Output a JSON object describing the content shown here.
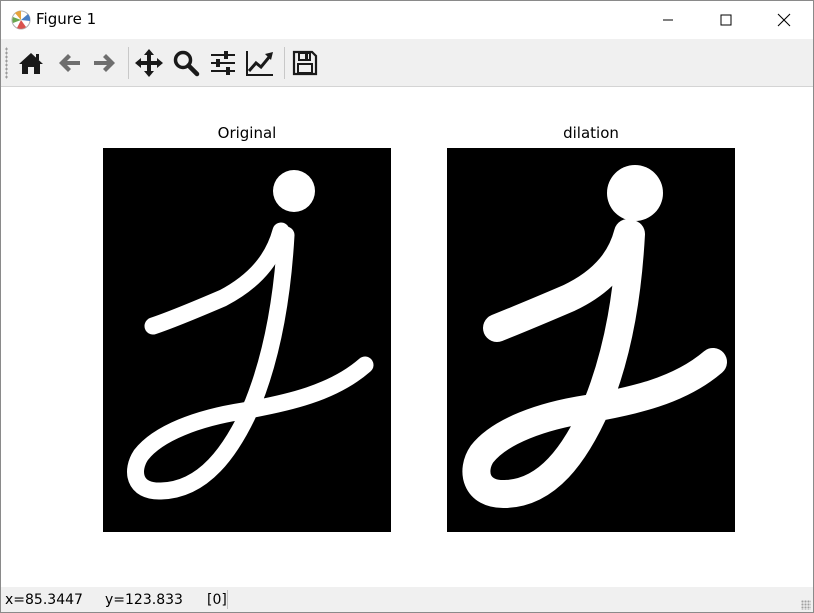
{
  "window": {
    "title": "Figure 1",
    "minimize_icon": "minimize-icon",
    "maximize_icon": "maximize-icon",
    "close_icon": "close-icon"
  },
  "toolbar": {
    "buttons": [
      {
        "name": "home-button",
        "icon": "home-icon"
      },
      {
        "name": "back-button",
        "icon": "arrow-left-icon"
      },
      {
        "name": "forward-button",
        "icon": "arrow-right-icon"
      },
      {
        "name": "pan-button",
        "icon": "move-icon"
      },
      {
        "name": "zoom-button",
        "icon": "magnifier-icon"
      },
      {
        "name": "configure-subplots-button",
        "icon": "sliders-icon"
      },
      {
        "name": "edit-axes-button",
        "icon": "line-chart-icon"
      },
      {
        "name": "save-button",
        "icon": "floppy-disk-icon"
      }
    ]
  },
  "figure": {
    "left_title": "Original",
    "right_title": "dilation"
  },
  "status": {
    "x": "x=85.3447",
    "y": "y=123.833",
    "value": "[0]"
  },
  "colors": {
    "image_background": "#000000",
    "stroke": "#ffffff",
    "toolbar_bg": "#f0f0f0",
    "icon_dark": "#1a1a1a",
    "icon_gray": "#6e6e6e"
  }
}
